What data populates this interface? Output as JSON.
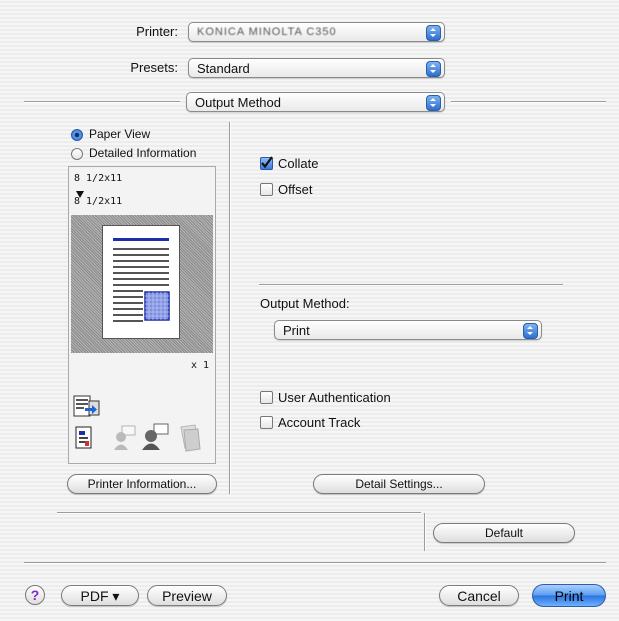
{
  "header": {
    "printer_label": "Printer:",
    "printer_value": "KONICA MINOLTA C350",
    "presets_label": "Presets:",
    "presets_value": "Standard",
    "panel_value": "Output Method"
  },
  "left_panel": {
    "view_options": [
      "Paper View",
      "Detailed Information"
    ],
    "selected_view": "Paper View",
    "paper_size_top": "8 1/2x11",
    "paper_size_bottom": "8 1/2x11",
    "copies": "x 1",
    "printer_info_button": "Printer Information..."
  },
  "right_panel": {
    "collate_label": "Collate",
    "collate_checked": true,
    "offset_label": "Offset",
    "offset_checked": false,
    "output_method_label": "Output Method:",
    "output_method_value": "Print",
    "user_auth_label": "User Authentication",
    "account_track_label": "Account Track",
    "detail_settings_button": "Detail Settings...",
    "default_button": "Default"
  },
  "footer": {
    "help_label": "?",
    "pdf_label": "PDF ▾",
    "preview_label": "Preview",
    "cancel_label": "Cancel",
    "print_label": "Print"
  }
}
